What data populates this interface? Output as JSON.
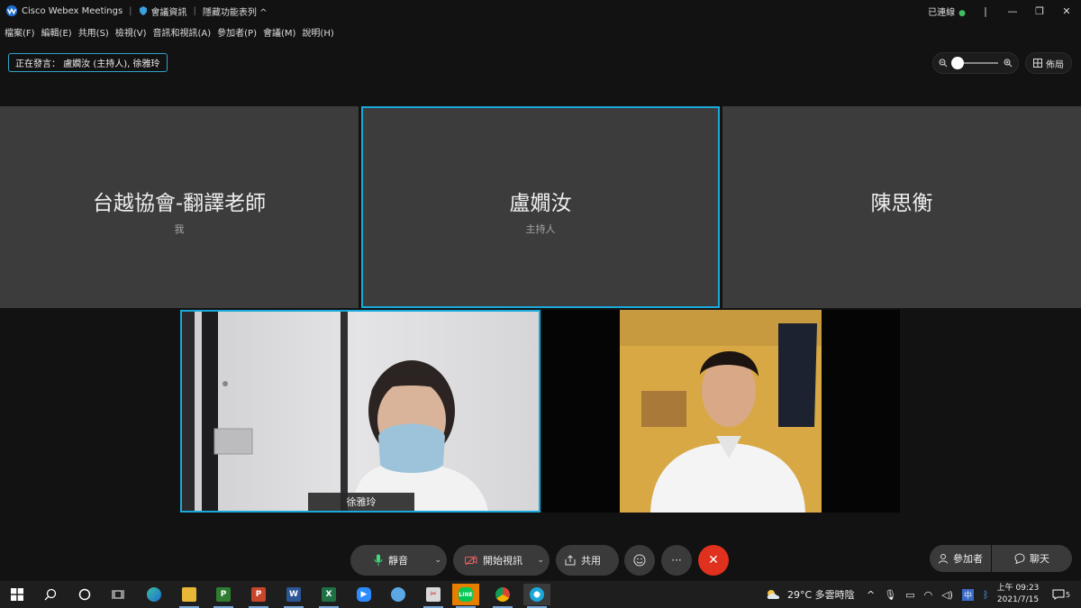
{
  "titlebar": {
    "app_title": "Cisco Webex Meetings",
    "meeting_info": "會議資訊",
    "hide_toolbar": "隱藏功能表列 ^",
    "status": "已連線"
  },
  "menu": {
    "items": [
      "檔案(F)",
      "編輯(E)",
      "共用(S)",
      "檢視(V)",
      "音訊和視訊(A)",
      "參加者(P)",
      "會議(M)",
      "說明(H)"
    ]
  },
  "speaking": {
    "label": "正在發言：",
    "names": "盧嫺汝 (主持人), 徐雅玲"
  },
  "zoom": {
    "level": 0.1
  },
  "layout": {
    "label": "佈局"
  },
  "tiles": [
    {
      "name": "台越協會-翻譯老師",
      "sub": "我"
    },
    {
      "name": "盧嫺汝",
      "sub": "主持人"
    },
    {
      "name": "陳思衡",
      "sub": ""
    }
  ],
  "videos": [
    {
      "name": "徐雅玲"
    },
    {
      "name": ""
    }
  ],
  "controls": {
    "mute": "靜音",
    "start_video": "開始視訊",
    "share": "共用",
    "more": "···",
    "participants": "參加者",
    "chat": "聊天"
  },
  "taskbar": {
    "weather": "29°C  多雲時陰",
    "time": "上午 09:23",
    "date": "2021/7/15",
    "notifications": "5"
  },
  "colors": {
    "accent": "#1aa9db",
    "end_call": "#e0301e",
    "connected": "#3fbf5f"
  }
}
